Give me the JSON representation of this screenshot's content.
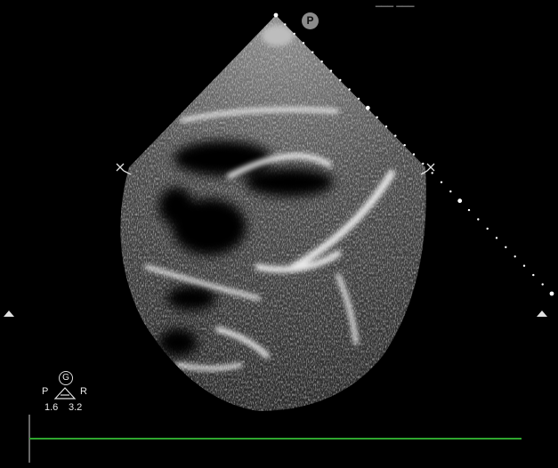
{
  "image": {
    "modality": "ultrasound echocardiogram sector scan",
    "colors": {
      "background": "#000000",
      "speckle": "#d9d9d9",
      "ecg_trace": "#2fa52f",
      "depth_markers": "#ffffff",
      "badge": "#8b8b8b"
    }
  },
  "header": {
    "readout": "___ ___"
  },
  "probe_badge": {
    "label": "P"
  },
  "legend": {
    "gain_label": "G",
    "left_label": "P",
    "right_label": "R",
    "left_value": "1.6",
    "right_value": "3.2"
  },
  "icons": {
    "left_focus": "focus-cross-icon",
    "right_focus": "focus-cross-icon",
    "left_arrow": "triangle-up-icon",
    "right_arrow": "triangle-up-icon"
  }
}
